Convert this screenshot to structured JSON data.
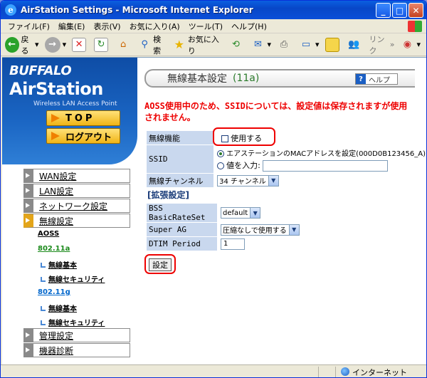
{
  "window": {
    "title": "AirStation Settings - Microsoft Internet Explorer"
  },
  "menu": [
    "ファイル(F)",
    "編集(E)",
    "表示(V)",
    "お気に入り(A)",
    "ツール(T)",
    "ヘルプ(H)"
  ],
  "toolbar": {
    "back": "戻る",
    "search": "検索",
    "favorites": "お気に入り",
    "links": "リンク"
  },
  "brand": {
    "buffalo": "BUFFALO",
    "product": "AirStation",
    "subtitle": "Wireless LAN Access Point"
  },
  "side_buttons": {
    "top": "TOP",
    "logout": "ログアウト"
  },
  "nav": {
    "wan": "WAN設定",
    "lan": "LAN設定",
    "network": "ネットワーク設定",
    "wireless": "無線設定",
    "aoss": "AOSS",
    "band_a": "802.11a",
    "a_basic": "無線基本",
    "a_security": "無線セキュリティ",
    "band_g": "802.11g",
    "g_basic": "無線基本",
    "g_security": "無線セキュリティ",
    "admin": "管理設定",
    "diagnostics": "機器診断"
  },
  "page": {
    "title": "無線基本設定",
    "band": "(11a)",
    "help": "ヘルプ"
  },
  "warning": "AOSS使用中のため、SSIDについては、設定値は保存されますが使用されません。",
  "form": {
    "wireless_function_label": "無線機能",
    "wireless_function_value": "使用する",
    "ssid_label": "SSID",
    "ssid_option_mac": "エアステーションのMACアドレスを設定(000D0B123456_A)",
    "ssid_option_input": "値を入力:",
    "channel_label": "無線チャンネル",
    "channel_value": "34 チャンネル",
    "extended_title": "[拡張設定]",
    "bss_label": "BSS BasicRateSet",
    "bss_value": "default",
    "superag_label": "Super AG",
    "superag_value": "圧縮なしで使用する",
    "dtim_label": "DTIM Period",
    "dtim_value": "1",
    "submit": "設定"
  },
  "status": {
    "zone": "インターネット"
  }
}
